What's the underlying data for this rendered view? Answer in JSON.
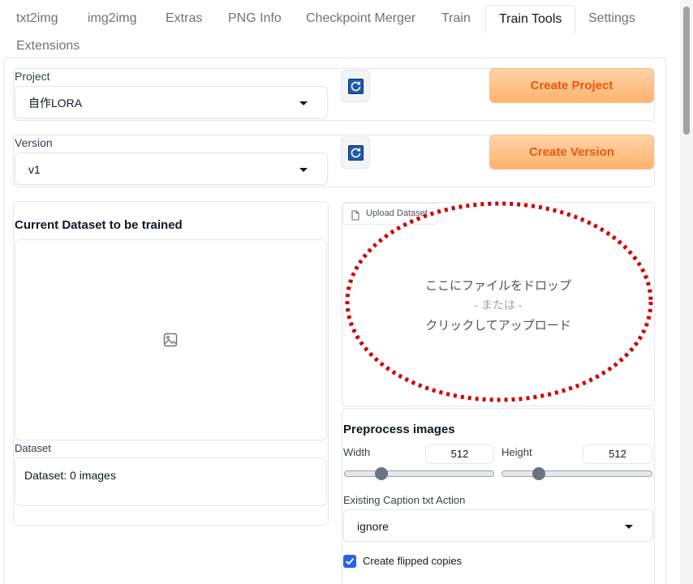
{
  "tabs": [
    {
      "label": "txt2img"
    },
    {
      "label": "img2img"
    },
    {
      "label": "Extras"
    },
    {
      "label": "PNG Info"
    },
    {
      "label": "Checkpoint Merger"
    },
    {
      "label": "Train"
    },
    {
      "label": "Train Tools"
    },
    {
      "label": "Settings"
    },
    {
      "label": "Extensions"
    }
  ],
  "active_tab": "Train Tools",
  "project": {
    "label": "Project",
    "value": "自作LORA",
    "create_label": "Create Project"
  },
  "version": {
    "label": "Version",
    "value": "v1",
    "create_label": "Create Version"
  },
  "dataset": {
    "heading": "Current Dataset to be trained",
    "label": "Dataset",
    "value": "Dataset: 0 images"
  },
  "upload": {
    "tab_label": "Upload Dataset",
    "drop_line1": "ここにファイルをドロップ",
    "drop_line2": "- または -",
    "drop_line3": "クリックしてアップロード"
  },
  "preprocess": {
    "heading": "Preprocess images",
    "width_label": "Width",
    "width_value": "512",
    "height_label": "Height",
    "height_value": "512",
    "caption_label": "Existing Caption txt Action",
    "caption_value": "ignore",
    "flip_label": "Create flipped copies",
    "flip_checked": true
  },
  "colors": {
    "accent_orange": "#ea580c",
    "annotation_red": "#d10000",
    "checkbox_blue": "#2563eb"
  }
}
